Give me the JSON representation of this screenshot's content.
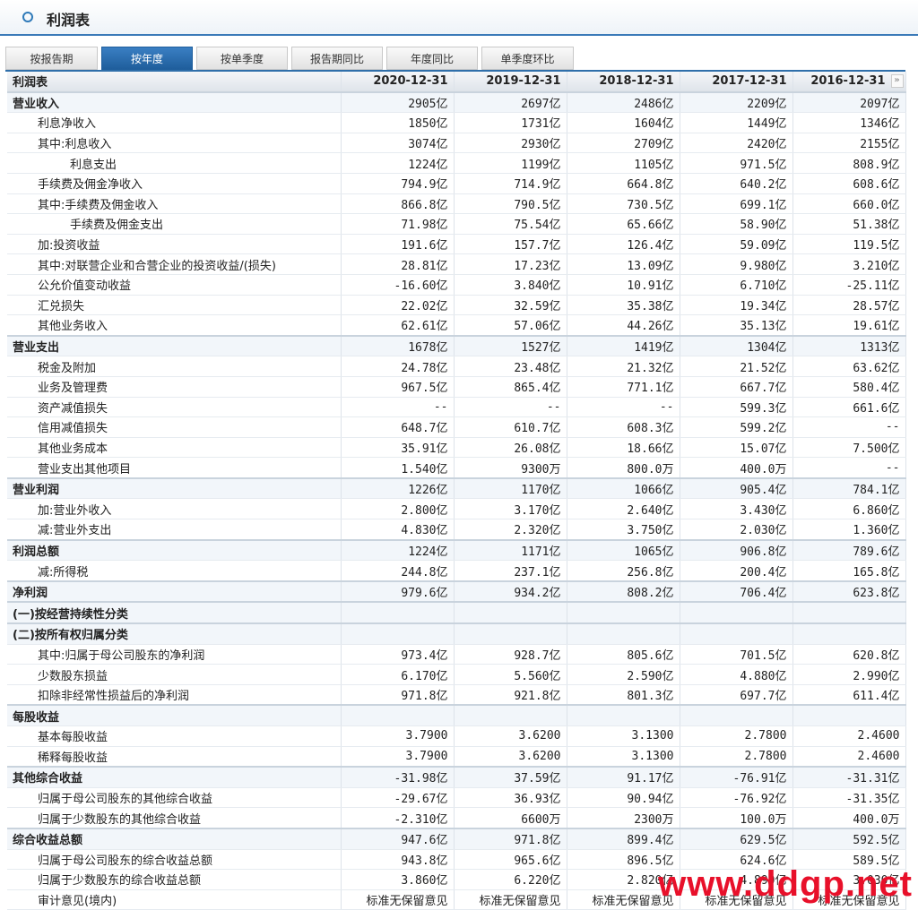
{
  "header": {
    "title": "利润表"
  },
  "tabs": [
    "按报告期",
    "按年度",
    "按单季度",
    "报告期同比",
    "年度同比",
    "单季度环比"
  ],
  "active_tab": 1,
  "columns": [
    "利润表",
    "2020-12-31",
    "2019-12-31",
    "2018-12-31",
    "2017-12-31",
    "2016-12-31"
  ],
  "more_icon": "»",
  "rows": [
    {
      "label": "营业收入",
      "lvl": 0,
      "vals": [
        "2905亿",
        "2697亿",
        "2486亿",
        "2209亿",
        "2097亿"
      ]
    },
    {
      "label": "利息净收入",
      "lvl": 1,
      "vals": [
        "1850亿",
        "1731亿",
        "1604亿",
        "1449亿",
        "1346亿"
      ]
    },
    {
      "label": "其中:利息收入",
      "lvl": 1,
      "vals": [
        "3074亿",
        "2930亿",
        "2709亿",
        "2420亿",
        "2155亿"
      ]
    },
    {
      "label": "利息支出",
      "lvl": 2,
      "vals": [
        "1224亿",
        "1199亿",
        "1105亿",
        "971.5亿",
        "808.9亿"
      ]
    },
    {
      "label": "手续费及佣金净收入",
      "lvl": 1,
      "vals": [
        "794.9亿",
        "714.9亿",
        "664.8亿",
        "640.2亿",
        "608.6亿"
      ]
    },
    {
      "label": "其中:手续费及佣金收入",
      "lvl": 1,
      "vals": [
        "866.8亿",
        "790.5亿",
        "730.5亿",
        "699.1亿",
        "660.0亿"
      ]
    },
    {
      "label": "手续费及佣金支出",
      "lvl": 2,
      "vals": [
        "71.98亿",
        "75.54亿",
        "65.66亿",
        "58.90亿",
        "51.38亿"
      ]
    },
    {
      "label": "加:投资收益",
      "lvl": 1,
      "vals": [
        "191.6亿",
        "157.7亿",
        "126.4亿",
        "59.09亿",
        "119.5亿"
      ]
    },
    {
      "label": "其中:对联营企业和合营企业的投资收益/(损失)",
      "lvl": 1,
      "vals": [
        "28.81亿",
        "17.23亿",
        "13.09亿",
        "9.980亿",
        "3.210亿"
      ]
    },
    {
      "label": "公允价值变动收益",
      "lvl": 1,
      "vals": [
        "-16.60亿",
        "3.840亿",
        "10.91亿",
        "6.710亿",
        "-25.11亿"
      ]
    },
    {
      "label": "汇兑损失",
      "lvl": 1,
      "vals": [
        "22.02亿",
        "32.59亿",
        "35.38亿",
        "19.34亿",
        "28.57亿"
      ]
    },
    {
      "label": "其他业务收入",
      "lvl": 1,
      "vals": [
        "62.61亿",
        "57.06亿",
        "44.26亿",
        "35.13亿",
        "19.61亿"
      ]
    },
    {
      "label": "营业支出",
      "lvl": 0,
      "vals": [
        "1678亿",
        "1527亿",
        "1419亿",
        "1304亿",
        "1313亿"
      ]
    },
    {
      "label": "税金及附加",
      "lvl": 1,
      "vals": [
        "24.78亿",
        "23.48亿",
        "21.32亿",
        "21.52亿",
        "63.62亿"
      ]
    },
    {
      "label": "业务及管理费",
      "lvl": 1,
      "vals": [
        "967.5亿",
        "865.4亿",
        "771.1亿",
        "667.7亿",
        "580.4亿"
      ]
    },
    {
      "label": "资产减值损失",
      "lvl": 1,
      "vals": [
        "--",
        "--",
        "--",
        "599.3亿",
        "661.6亿"
      ]
    },
    {
      "label": "信用减值损失",
      "lvl": 1,
      "vals": [
        "648.7亿",
        "610.7亿",
        "608.3亿",
        "599.2亿",
        "--"
      ]
    },
    {
      "label": "其他业务成本",
      "lvl": 1,
      "vals": [
        "35.91亿",
        "26.08亿",
        "18.66亿",
        "15.07亿",
        "7.500亿"
      ]
    },
    {
      "label": "营业支出其他项目",
      "lvl": 1,
      "vals": [
        "1.540亿",
        "9300万",
        "800.0万",
        "400.0万",
        "--"
      ]
    },
    {
      "label": "营业利润",
      "lvl": 0,
      "vals": [
        "1226亿",
        "1170亿",
        "1066亿",
        "905.4亿",
        "784.1亿"
      ]
    },
    {
      "label": "加:营业外收入",
      "lvl": 1,
      "vals": [
        "2.800亿",
        "3.170亿",
        "2.640亿",
        "3.430亿",
        "6.860亿"
      ]
    },
    {
      "label": "减:营业外支出",
      "lvl": 1,
      "vals": [
        "4.830亿",
        "2.320亿",
        "3.750亿",
        "2.030亿",
        "1.360亿"
      ]
    },
    {
      "label": "利润总额",
      "lvl": 0,
      "vals": [
        "1224亿",
        "1171亿",
        "1065亿",
        "906.8亿",
        "789.6亿"
      ]
    },
    {
      "label": "减:所得税",
      "lvl": 1,
      "vals": [
        "244.8亿",
        "237.1亿",
        "256.8亿",
        "200.4亿",
        "165.8亿"
      ]
    },
    {
      "label": "净利润",
      "lvl": 0,
      "vals": [
        "979.6亿",
        "934.2亿",
        "808.2亿",
        "706.4亿",
        "623.8亿"
      ]
    },
    {
      "label": "(一)按经营持续性分类",
      "lvl": 0,
      "vals": [
        "",
        "",
        "",
        "",
        ""
      ]
    },
    {
      "label": "(二)按所有权归属分类",
      "lvl": 0,
      "vals": [
        "",
        "",
        "",
        "",
        ""
      ]
    },
    {
      "label": "其中:归属于母公司股东的净利润",
      "lvl": 1,
      "vals": [
        "973.4亿",
        "928.7亿",
        "805.6亿",
        "701.5亿",
        "620.8亿"
      ]
    },
    {
      "label": "少数股东损益",
      "lvl": 1,
      "vals": [
        "6.170亿",
        "5.560亿",
        "2.590亿",
        "4.880亿",
        "2.990亿"
      ]
    },
    {
      "label": "扣除非经常性损益后的净利润",
      "lvl": 1,
      "vals": [
        "971.8亿",
        "921.8亿",
        "801.3亿",
        "697.7亿",
        "611.4亿"
      ]
    },
    {
      "label": "每股收益",
      "lvl": 0,
      "vals": [
        "",
        "",
        "",
        "",
        ""
      ]
    },
    {
      "label": "基本每股收益",
      "lvl": 1,
      "vals": [
        "3.7900",
        "3.6200",
        "3.1300",
        "2.7800",
        "2.4600"
      ]
    },
    {
      "label": "稀释每股收益",
      "lvl": 1,
      "vals": [
        "3.7900",
        "3.6200",
        "3.1300",
        "2.7800",
        "2.4600"
      ]
    },
    {
      "label": "其他综合收益",
      "lvl": 0,
      "vals": [
        "-31.98亿",
        "37.59亿",
        "91.17亿",
        "-76.91亿",
        "-31.31亿"
      ]
    },
    {
      "label": "归属于母公司股东的其他综合收益",
      "lvl": 1,
      "vals": [
        "-29.67亿",
        "36.93亿",
        "90.94亿",
        "-76.92亿",
        "-31.35亿"
      ]
    },
    {
      "label": "归属于少数股东的其他综合收益",
      "lvl": 1,
      "vals": [
        "-2.310亿",
        "6600万",
        "2300万",
        "100.0万",
        "400.0万"
      ]
    },
    {
      "label": "综合收益总额",
      "lvl": 0,
      "vals": [
        "947.6亿",
        "971.8亿",
        "899.4亿",
        "629.5亿",
        "592.5亿"
      ]
    },
    {
      "label": "归属于母公司股东的综合收益总额",
      "lvl": 1,
      "vals": [
        "943.8亿",
        "965.6亿",
        "896.5亿",
        "624.6亿",
        "589.5亿"
      ]
    },
    {
      "label": "归属于少数股东的综合收益总额",
      "lvl": 1,
      "vals": [
        "3.860亿",
        "6.220亿",
        "2.820亿",
        "4.890亿",
        "3.030亿"
      ]
    },
    {
      "label": "审计意见(境内)",
      "lvl": 1,
      "vals": [
        "标准无保留意见",
        "标准无保留意见",
        "标准无保留意见",
        "标准无保留意见",
        "标准无保留意见"
      ]
    }
  ],
  "watermark": "www.ddgp.net"
}
